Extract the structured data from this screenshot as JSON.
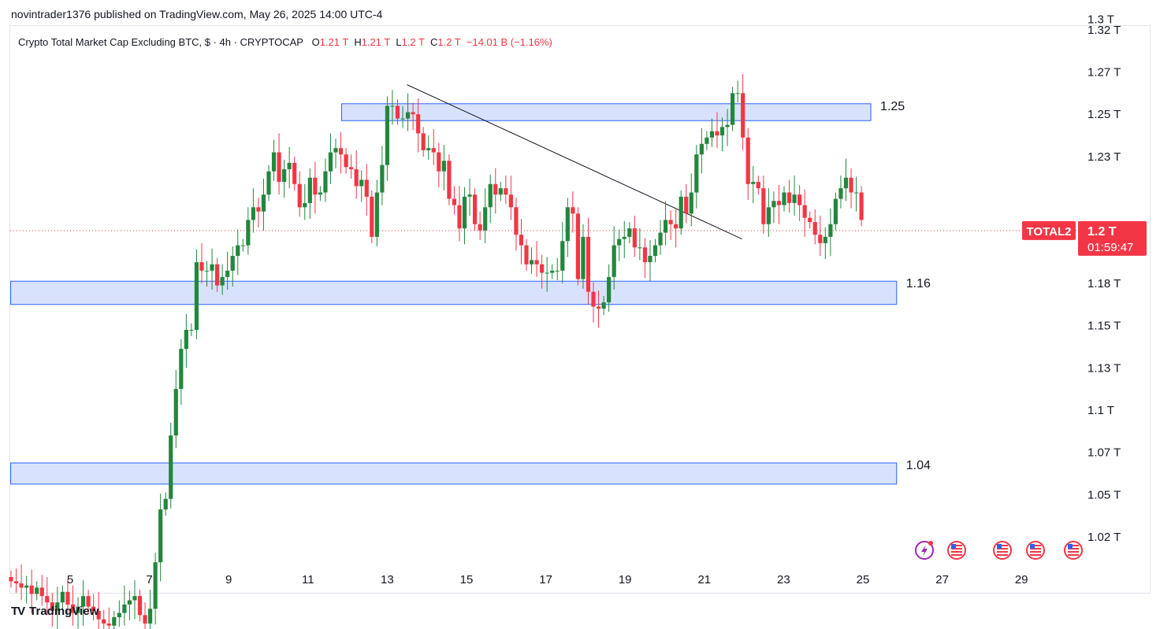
{
  "header": {
    "publisher_line": "novintrader1376 published on TradingView.com, May 26, 2025 14:00 UTC-4"
  },
  "legend": {
    "symbol_line": "Crypto Total Market Cap Excluding BTC, $ · 4h · CRYPTOCAP",
    "open_label": "O",
    "open": "1.21 T",
    "high_label": "H",
    "high": "1.21 T",
    "low_label": "L",
    "low": "1.2 T",
    "close_label": "C",
    "close": "1.2 T",
    "change": "−14.01 B (−1.16%)"
  },
  "price_tag": {
    "symbol": "TOTAL2",
    "price": "1.2 T",
    "countdown": "01:59:47"
  },
  "footer": {
    "brand": "TradingView",
    "logo_glyph": "TV"
  },
  "colors": {
    "up": "#22873d",
    "down": "#f23645",
    "zone_fill": "#d2ddfb",
    "zone_border": "#2962ff"
  },
  "icons": [
    "lightning-event-icon",
    "us-flag-event-icon",
    "us-flag-event-icon",
    "us-flag-event-icon",
    "us-flag-event-icon"
  ],
  "chart_data": {
    "type": "candlestick",
    "interval": "4h",
    "y_unit": "T",
    "ylim": [
      1.0,
      1.32
    ],
    "y_ticks": [
      "1.32 T",
      "1.3 T",
      "1.27 T",
      "1.25 T",
      "1.23 T",
      "1.18 T",
      "1.15 T",
      "1.13 T",
      "1.1 T",
      "1.07 T",
      "1.05 T",
      "1.02 T"
    ],
    "y_tick_values": [
      1.32,
      1.3,
      1.275,
      1.255,
      1.235,
      1.175,
      1.155,
      1.135,
      1.115,
      1.095,
      1.075,
      1.055
    ],
    "x_ticks": [
      "5",
      "7",
      "9",
      "11",
      "13",
      "15",
      "17",
      "19",
      "21",
      "23",
      "25",
      "27",
      "29"
    ],
    "x_tick_days": [
      5,
      7,
      9,
      11,
      13,
      15,
      17,
      19,
      21,
      23,
      25,
      27,
      29
    ],
    "x_start_day": 4.5,
    "zones": [
      {
        "label": "1.25",
        "top": 1.26,
        "bottom": 1.252,
        "from_day": 11.85,
        "to_day": 25.2
      },
      {
        "label": "1.16",
        "top": 1.176,
        "bottom": 1.165,
        "from_day": 3.5,
        "to_day": 25.85
      },
      {
        "label": "1.04",
        "top": 1.09,
        "bottom": 1.08,
        "from_day": 3.5,
        "to_day": 25.85
      }
    ],
    "trendline": {
      "from": [
        13.5,
        1.269
      ],
      "to": [
        21.95,
        1.196
      ]
    },
    "last_price": 1.2,
    "closes": [
      1.034,
      1.033,
      1.031,
      1.032,
      1.028,
      1.031,
      1.027,
      1.024,
      1.02,
      1.024,
      1.029,
      1.023,
      1.019,
      1.022,
      1.027,
      1.022,
      1.02,
      1.016,
      1.014,
      1.013,
      1.017,
      1.019,
      1.023,
      1.025,
      1.027,
      1.018,
      1.014,
      1.021,
      1.043,
      1.068,
      1.073,
      1.103,
      1.125,
      1.144,
      1.153,
      1.153,
      1.185,
      1.181,
      1.181,
      1.184,
      1.174,
      1.178,
      1.181,
      1.188,
      1.193,
      1.193,
      1.205,
      1.211,
      1.209,
      1.217,
      1.228,
      1.237,
      1.223,
      1.229,
      1.232,
      1.222,
      1.211,
      1.213,
      1.225,
      1.217,
      1.218,
      1.228,
      1.237,
      1.239,
      1.236,
      1.23,
      1.229,
      1.221,
      1.224,
      1.216,
      1.197,
      1.218,
      1.231,
      1.259,
      1.259,
      1.253,
      1.253,
      1.256,
      1.255,
      1.246,
      1.238,
      1.239,
      1.237,
      1.228,
      1.233,
      1.215,
      1.212,
      1.201,
      1.216,
      1.217,
      1.203,
      1.2,
      1.211,
      1.222,
      1.217,
      1.22,
      1.217,
      1.211,
      1.198,
      1.193,
      1.184,
      1.186,
      1.184,
      1.18,
      1.18,
      1.181,
      1.181,
      1.195,
      1.211,
      1.208,
      1.177,
      1.197,
      1.171,
      1.164,
      1.163,
      1.166,
      1.178,
      1.193,
      1.196,
      1.197,
      1.201,
      1.192,
      1.192,
      1.185,
      1.188,
      1.193,
      1.199,
      1.205,
      1.203,
      1.201,
      1.216,
      1.208,
      1.218,
      1.236,
      1.241,
      1.244,
      1.247,
      1.245,
      1.249,
      1.25,
      1.265,
      1.265,
      1.244,
      1.222,
      1.223,
      1.22,
      1.203,
      1.211,
      1.214,
      1.212,
      1.218,
      1.213,
      1.217,
      1.212,
      1.206,
      1.204,
      1.198,
      1.194,
      1.197,
      1.203,
      1.215,
      1.22,
      1.225,
      1.218,
      1.218,
      1.205
    ]
  }
}
